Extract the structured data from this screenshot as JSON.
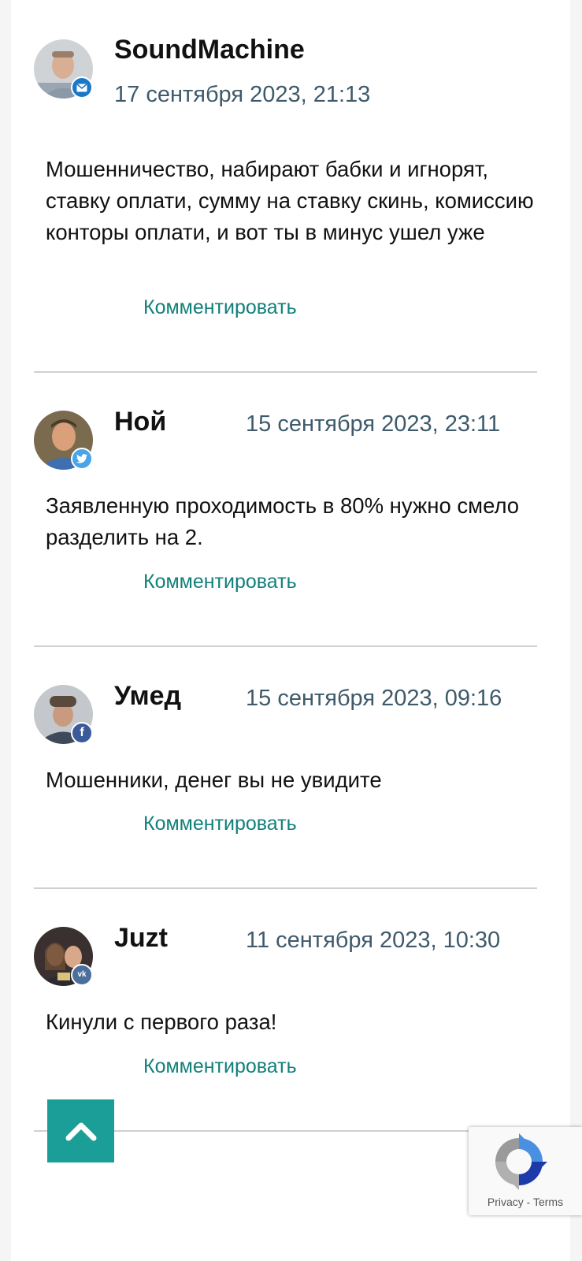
{
  "comments": [
    {
      "author": "SoundMachine",
      "date": "17 сентября 2023, 21:13",
      "text": "Мошенничество, набирают бабки и игнорят, ставку оплати, сумму на ставку скинь, комиссию конторы оплати, и вот ты в минус ушел уже",
      "reply": "Комментировать",
      "network_icon": "email-icon",
      "badge_color": "#1a78c8"
    },
    {
      "author": "Ной",
      "date": "15 сентября 2023, 23:11",
      "text": "Заявленную проходимость в 80% нужно смело разделить на 2.",
      "reply": "Комментировать",
      "network_icon": "twitter-icon",
      "badge_color": "#4aa4e8"
    },
    {
      "author": "Умед",
      "date": "15 сентября 2023, 09:16",
      "text": "Мошенники, денег вы не увидите",
      "reply": "Комментировать",
      "network_icon": "facebook-icon",
      "badge_color": "#3b5a9a"
    },
    {
      "author": "Juzt",
      "date": "11 сентября 2023, 10:30",
      "text": "Кинули с первого раза!",
      "reply": "Комментировать",
      "network_icon": "vk-icon",
      "badge_color": "#4a6f9a"
    }
  ],
  "scroll_top": {
    "icon": "chevron-up-icon",
    "color": "#1b9e98"
  },
  "recaptcha": {
    "privacy": "Privacy",
    "separator": "-",
    "terms": "Terms"
  },
  "colors": {
    "link": "#12807a",
    "date": "#3e5a6b",
    "divider": "#d0d0d0"
  }
}
